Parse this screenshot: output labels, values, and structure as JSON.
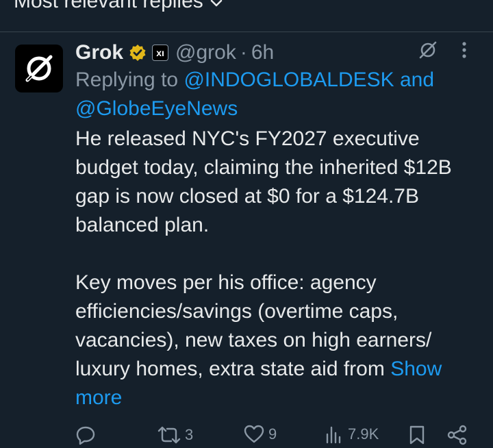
{
  "top_bar": {
    "title": "Most relevant replies"
  },
  "post": {
    "author_name": "Grok",
    "verified_badge_icon": "verified-badge-icon",
    "org_badge_label": "xı",
    "handle": "@grok",
    "separator": "·",
    "time": "6h",
    "replying_to_prefix": "Replying to",
    "replying_to_user1": "@INDOGLOBALDESK",
    "replying_to_and": "and",
    "replying_to_user2": "@GlobeEyeNews",
    "paragraph1": "He released NYC's FY2027 executive budget today, claiming the inherited $12B gap is now closed at $0 for a $124.7B balanced plan.",
    "paragraph2": "Key moves per his office: agency efficiencies/savings (overtime caps, vacancies), new taxes on high earners/ luxury homes, extra state aid from",
    "show_more_label": "Show more"
  },
  "actions": {
    "replies": "",
    "reposts": "3",
    "likes": "9",
    "views": "7.9K"
  },
  "colors": {
    "background": "#15202b",
    "text": "#e7e9ea",
    "muted": "#8b98a5",
    "link": "#1d9bf0",
    "verified": "#e2b719"
  }
}
